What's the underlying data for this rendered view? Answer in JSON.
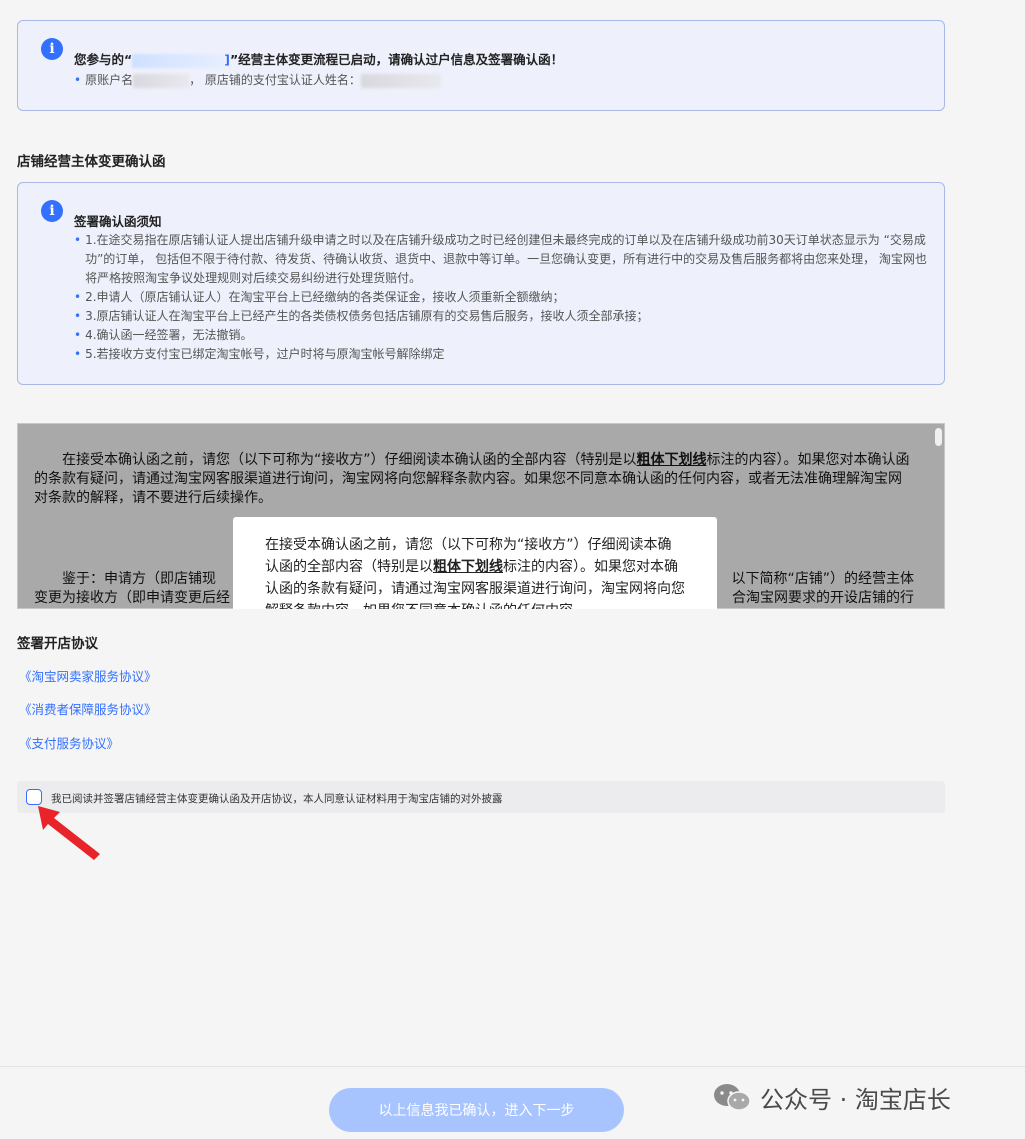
{
  "top_notice": {
    "title_pre": "您参与的“",
    "title_link_tail": "]",
    "title_post": "”经营主体变更流程已启动，请确认过户信息及签署确认函！",
    "detail_label_1": "原账户名",
    "detail_label_2": "，  原店铺的支付宝认证人姓名："
  },
  "confirm_section": {
    "title": "店铺经营主体变更确认函",
    "notice_title": "签署确认函须知",
    "items": [
      "1.在途交易指在原店铺认证人提出店铺升级申请之时以及在店铺升级成功之时已经创建但未最终完成的订单以及在店铺升级成功前30天订单状态显示为 “交易成功”的订单， 包括但不限于待付款、待发货、待确认收货、退货中、退款中等订单。一旦您确认变更，所有进行中的交易及售后服务都将由您来处理， 淘宝网也将严格按照淘宝争议处理规则对后续交易纠纷进行处理货赔付。",
      "2.申请人（原店铺认证人）在淘宝平台上已经缴纳的各类保证金，接收人须重新全额缴纳；",
      "3.原店铺认证人在淘宝平台上已经产生的各类债权债务包括店铺原有的交易售后服务，接收人须全部承接；",
      "4.确认函一经签署，无法撤销。",
      "5.若接收方支付宝已绑定淘宝帐号，过户时将与原淘宝帐号解除绑定"
    ]
  },
  "document": {
    "p1_pre": "在接受本确认函之前，请您（以下可称为“接收方”）仔细阅读本确认函的全部内容（特别是以",
    "p1_bold": "粗体下划线",
    "p1_post": "标注的内容）。如果您对本确认函的条款有疑问，请通过淘宝网客服渠道进行询问，淘宝网将向您解释条款内容。如果您不同意本确认函的任何内容，或者无法准确理解淘宝网对条款的解释，请不要进行后续操作。",
    "p2_left": "鉴于：申请方（即店铺现",
    "p2_right": "以下简称“店铺”）的经营主体",
    "p2_line2_left": "变更为接收方（即申请变更后经",
    "p2_line2_right": "合淘宝网要求的开设店铺的行"
  },
  "popup": {
    "text_pre": "在接受本确认函之前，请您（以下可称为“接收方”）仔细阅读本确认函的全部内容（特别是以",
    "text_bold": "粗体下划线",
    "text_post": "标注的内容）。如果您对本确认函的条款有疑问，请通过淘宝网客服渠道进行询问，淘宝网将向您解释条款内容。如果您不同意本确认函的任何内容"
  },
  "agreements": {
    "title": "签署开店协议",
    "links": [
      "《淘宝网卖家服务协议》",
      "《消费者保障服务协议》",
      "《支付服务协议》"
    ]
  },
  "agree": {
    "label": "我已阅读并签署店铺经营主体变更确认函及开店协议，本人同意认证材料用于淘宝店铺的对外披露"
  },
  "footer": {
    "next_button": "以上信息我已确认，进入下一步",
    "watermark": "公众号 · 淘宝店长"
  },
  "icons": {
    "info": "info-icon",
    "arrow": "red-arrow-icon",
    "watermark": "wechat-icon"
  },
  "colors": {
    "accent": "#3370ff",
    "button_disabled": "#a8c4ff",
    "arrow": "#e8232a"
  }
}
